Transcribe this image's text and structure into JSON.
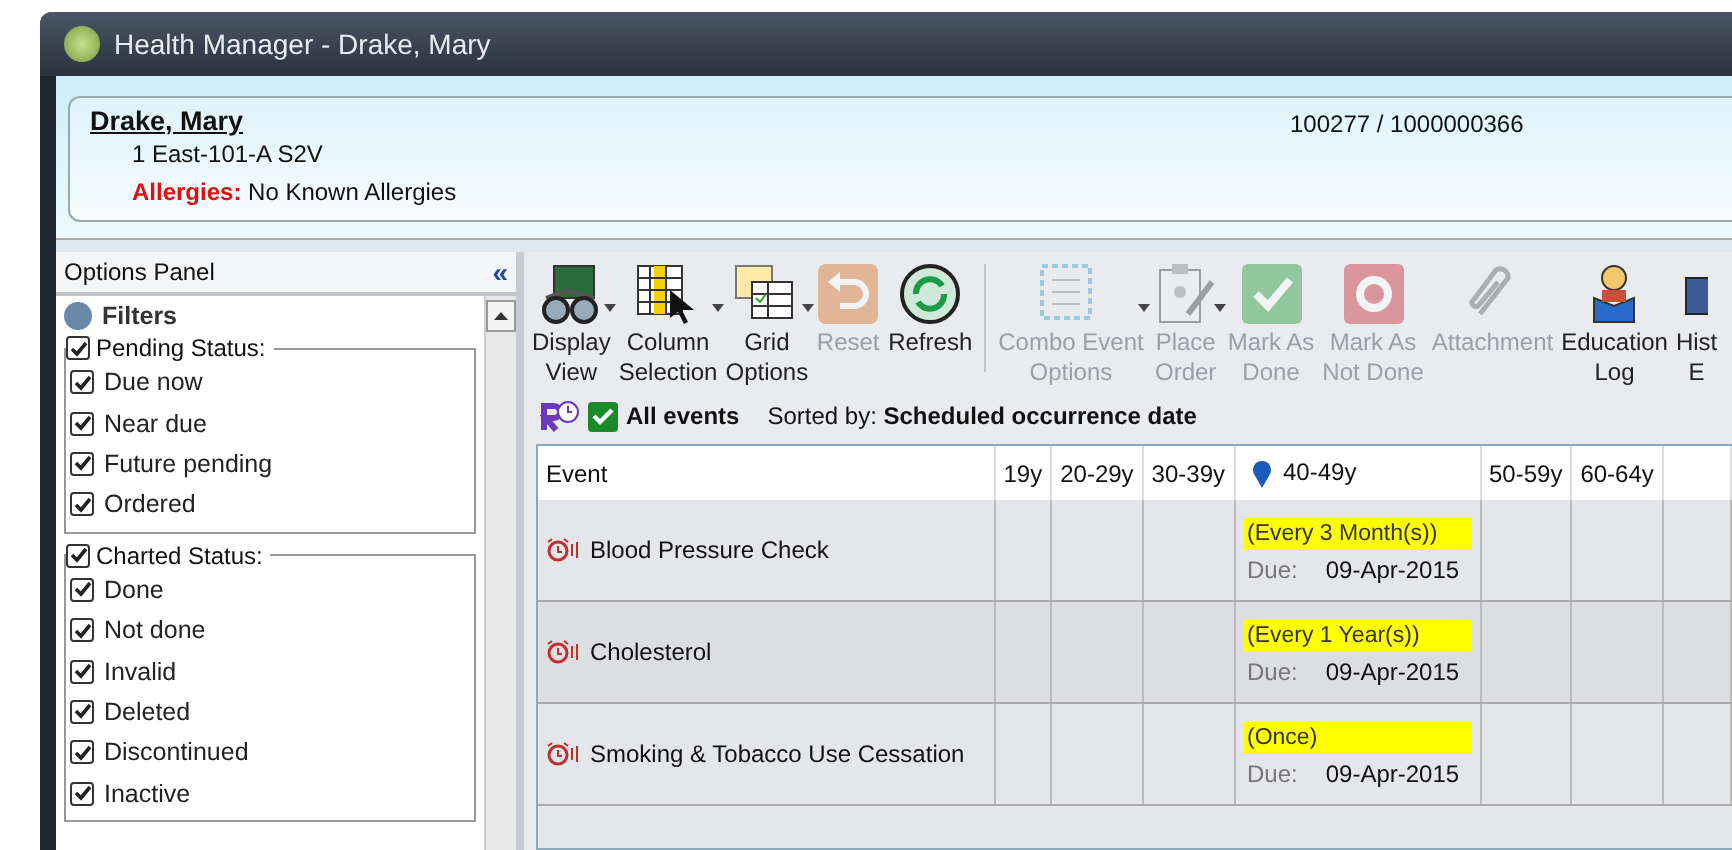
{
  "window": {
    "title": "Health Manager - Drake, Mary"
  },
  "patient": {
    "name": "Drake, Mary",
    "location": "1 East-101-A S2V",
    "allergy_label": "Allergies:",
    "allergy_value": "No Known Allergies",
    "ids": "100277 / 1000000366"
  },
  "options_panel": {
    "title": "Options Panel",
    "collapse_glyph": "«",
    "section": "Filters",
    "groups": [
      {
        "label": "Pending Status:",
        "checked": true,
        "items": [
          {
            "label": "Due now",
            "checked": true
          },
          {
            "label": "Near due",
            "checked": true
          },
          {
            "label": "Future pending",
            "checked": true
          },
          {
            "label": "Ordered",
            "checked": true
          }
        ]
      },
      {
        "label": "Charted Status:",
        "checked": true,
        "items": [
          {
            "label": "Done",
            "checked": true
          },
          {
            "label": "Not done",
            "checked": true
          },
          {
            "label": "Invalid",
            "checked": true
          },
          {
            "label": "Deleted",
            "checked": true
          },
          {
            "label": "Discontinued",
            "checked": true
          },
          {
            "label": "Inactive",
            "checked": true
          }
        ]
      }
    ]
  },
  "toolbar": [
    {
      "kind": "glasses",
      "lines": [
        "Display",
        "View"
      ],
      "disabled": false,
      "menu": true
    },
    {
      "kind": "columns",
      "lines": [
        "Column",
        "Selection"
      ],
      "disabled": false,
      "menu": true
    },
    {
      "kind": "grid",
      "lines": [
        "Grid",
        "Options"
      ],
      "disabled": false,
      "menu": true
    },
    {
      "kind": "reset",
      "lines": [
        "Reset"
      ],
      "disabled": true,
      "menu": false
    },
    {
      "kind": "refresh",
      "lines": [
        "Refresh"
      ],
      "disabled": false,
      "menu": false
    },
    {
      "kind": "combo",
      "lines": [
        "Combo Event",
        "Options"
      ],
      "disabled": true,
      "menu": true
    },
    {
      "kind": "clipboard",
      "lines": [
        "Place",
        "Order"
      ],
      "disabled": true,
      "menu": true
    },
    {
      "kind": "done",
      "lines": [
        "Mark As",
        "Done"
      ],
      "disabled": true,
      "menu": false
    },
    {
      "kind": "notdone",
      "lines": [
        "Mark As",
        "Not Done"
      ],
      "disabled": true,
      "menu": false
    },
    {
      "kind": "clip",
      "lines": [
        "Attachment"
      ],
      "disabled": true,
      "menu": false
    },
    {
      "kind": "reader",
      "lines": [
        "Education",
        "Log"
      ],
      "disabled": false,
      "menu": false
    },
    {
      "kind": "history",
      "lines": [
        "Hist",
        "E"
      ],
      "disabled": false,
      "menu": false
    }
  ],
  "filter_bar": {
    "all_events": "All events",
    "all_checked": true,
    "sorted_label": "Sorted by:",
    "sorted_value": "Scheduled occurrence date"
  },
  "table": {
    "columns": [
      {
        "label": "Event",
        "current": false
      },
      {
        "label": "19y",
        "current": false
      },
      {
        "label": "20-29y",
        "current": false
      },
      {
        "label": "30-39y",
        "current": false
      },
      {
        "label": "40-49y",
        "current": true
      },
      {
        "label": "50-59y",
        "current": false
      },
      {
        "label": "60-64y",
        "current": false
      }
    ],
    "rows": [
      {
        "event": "Blood Pressure Check",
        "frequency": "(Every 3 Month(s))",
        "due_label": "Due:",
        "due": "09-Apr-2015"
      },
      {
        "event": "Cholesterol",
        "frequency": "(Every 1 Year(s))",
        "due_label": "Due:",
        "due": "09-Apr-2015"
      },
      {
        "event": "Smoking & Tobacco Use Cessation",
        "frequency": "(Once)",
        "due_label": "Due:",
        "due": "09-Apr-2015"
      }
    ]
  }
}
